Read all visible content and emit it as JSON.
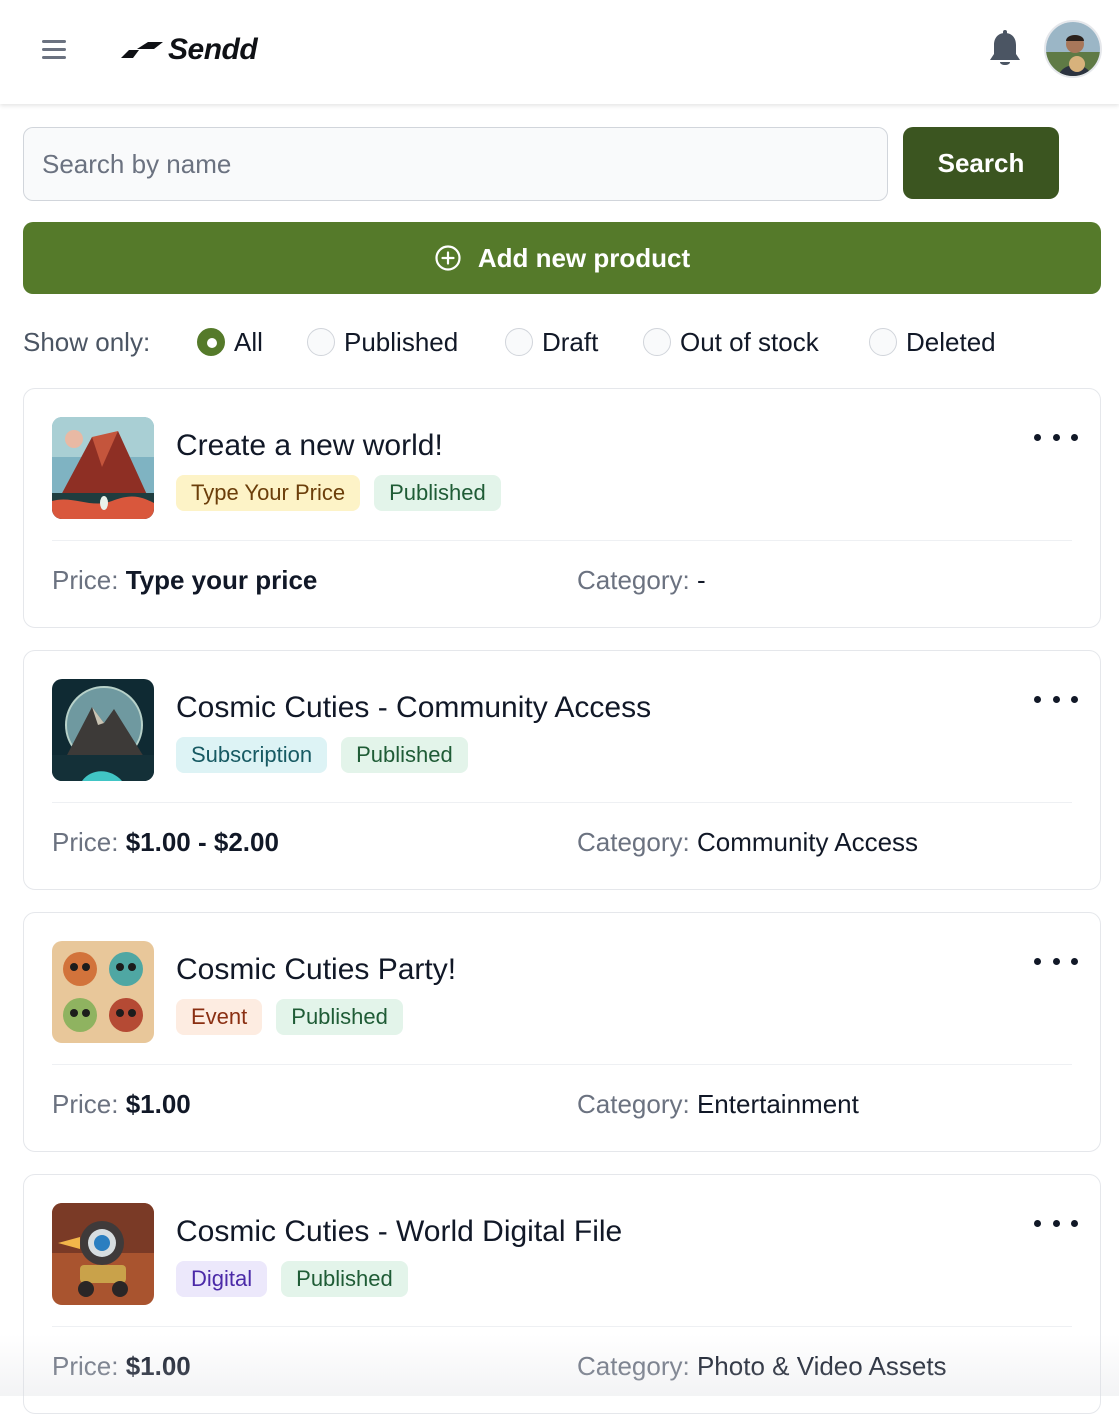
{
  "header": {
    "brand": "Sendd",
    "menu_icon": "hamburger-menu-icon",
    "notification_icon": "bell-icon"
  },
  "search": {
    "placeholder": "Search by name",
    "value": "",
    "button_label": "Search"
  },
  "add_product": {
    "label": "Add new product",
    "icon": "plus-circle-icon"
  },
  "filters": {
    "label": "Show only:",
    "selected": "All",
    "options": [
      "All",
      "Published",
      "Draft",
      "Out of stock",
      "Deleted"
    ]
  },
  "labels": {
    "price": "Price:",
    "category": "Category:"
  },
  "colors": {
    "accent": "#557a2a",
    "accent_dark": "#3b5520"
  },
  "products": [
    {
      "title": "Create a new world!",
      "badges": [
        {
          "text": "Type Your Price",
          "bg": "#fdf3c7",
          "fg": "#6b3e0a"
        },
        {
          "text": "Published",
          "bg": "#e3f4ea",
          "fg": "#1f5c36"
        }
      ],
      "price": "Type your price",
      "category": "-"
    },
    {
      "title": "Cosmic Cuties - Community Access",
      "badges": [
        {
          "text": "Subscription",
          "bg": "#ddf3f5",
          "fg": "#175a63"
        },
        {
          "text": "Published",
          "bg": "#e3f4ea",
          "fg": "#1f5c36"
        }
      ],
      "price": "$1.00 - $2.00",
      "category": "Community Access"
    },
    {
      "title": "Cosmic Cuties Party!",
      "badges": [
        {
          "text": "Event",
          "bg": "#fdece1",
          "fg": "#8a2f12"
        },
        {
          "text": "Published",
          "bg": "#e3f4ea",
          "fg": "#1f5c36"
        }
      ],
      "price": "$1.00",
      "category": "Entertainment"
    },
    {
      "title": "Cosmic Cuties - World Digital File",
      "badges": [
        {
          "text": "Digital",
          "bg": "#ece8fb",
          "fg": "#4b2aa8"
        },
        {
          "text": "Published",
          "bg": "#e3f4ea",
          "fg": "#1f5c36"
        }
      ],
      "price": "$1.00",
      "category": "Photo & Video Assets"
    }
  ]
}
